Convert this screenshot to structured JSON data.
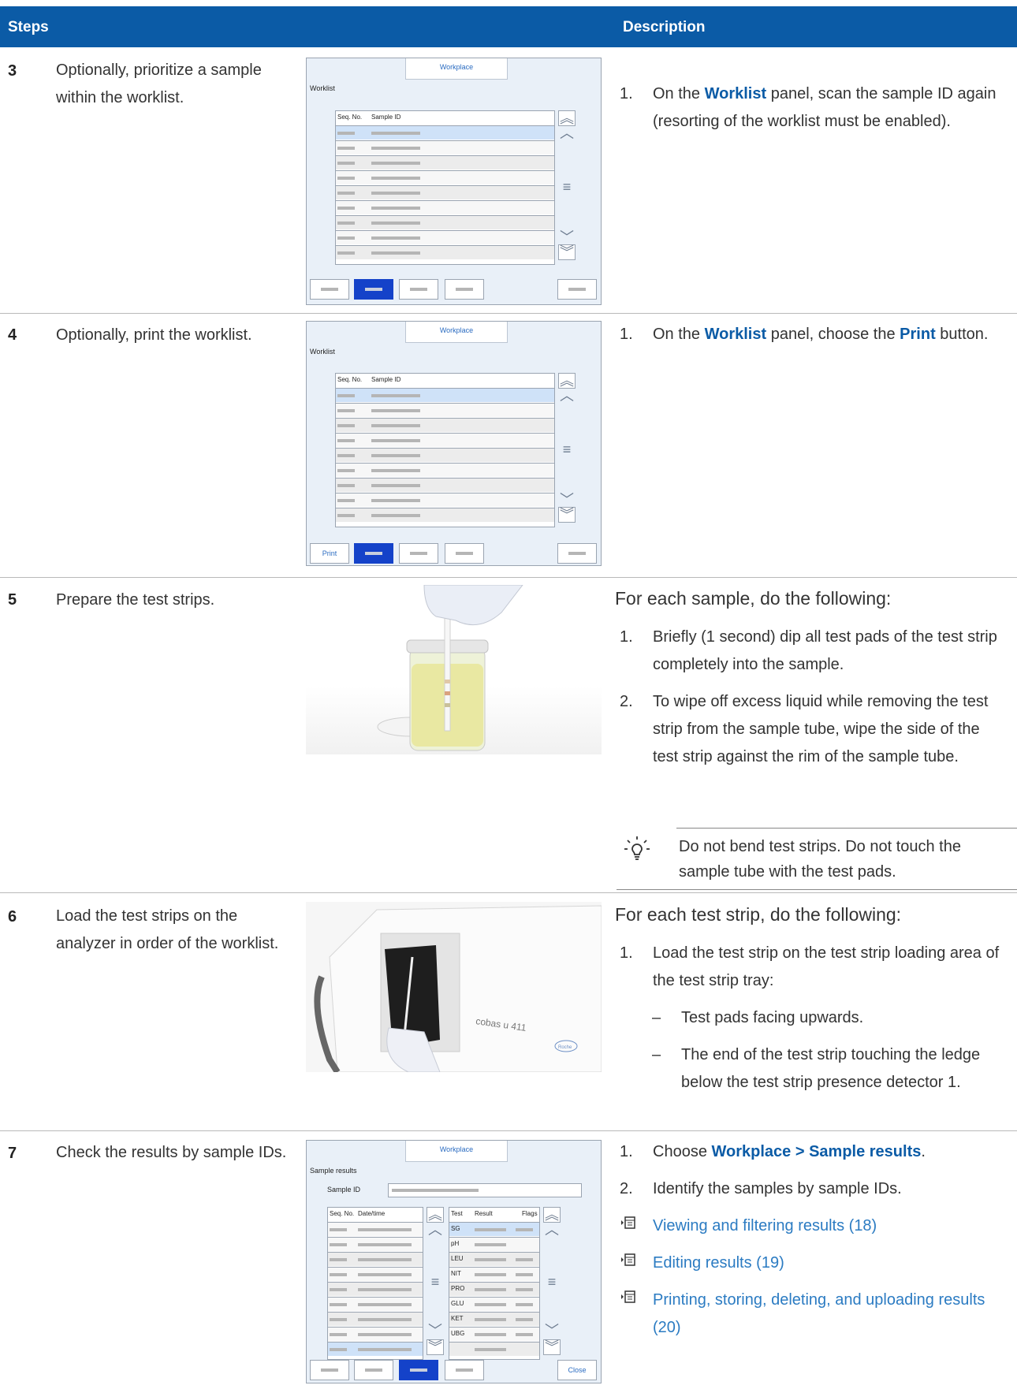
{
  "header": {
    "steps": "Steps",
    "description": "Description"
  },
  "rows": [
    {
      "num": "3",
      "text": "Optionally, prioritize a sample within the worklist.",
      "desc": {
        "n": "1.",
        "pre": "On the ",
        "bold": "Worklist",
        "post": " panel, scan the sample ID again (resorting of the worklist must be enabled)."
      }
    },
    {
      "num": "4",
      "text": "Optionally, print the worklist.",
      "desc": {
        "n": "1.",
        "pre": "On the ",
        "bold1": "Worklist",
        "mid": " panel, choose the ",
        "bold2": "Print",
        "post": " button."
      }
    },
    {
      "num": "5",
      "text": "Prepare the test strips.",
      "intro": "For each sample, do the following:",
      "items": [
        {
          "n": "1.",
          "t": "Briefly (1 second) dip all test pads of the test strip completely into the sample."
        },
        {
          "n": "2.",
          "t": "To wipe off excess liquid while removing the test strip from the sample tube, wipe the side of the test strip against the rim of the sample tube."
        }
      ],
      "tip": "Do not bend test strips. Do not touch the sample tube with the test pads."
    },
    {
      "num": "6",
      "text": "Load the test strips on the analyzer in order of the worklist.",
      "intro": "For each test strip, do the following:",
      "items": [
        {
          "n": "1.",
          "t": "Load the test strip on the test strip loading area of the test strip tray:"
        }
      ],
      "dashes": [
        "Test pads facing upwards.",
        "The end of the test strip touching the ledge below the test strip presence detector 1."
      ],
      "brand": "cobas u 411",
      "logo": "Roche"
    },
    {
      "num": "7",
      "text": "Check the results by sample IDs.",
      "items": [
        {
          "n": "1.",
          "pre": "Choose ",
          "bold": "Workplace > Sample results",
          "post": "."
        },
        {
          "n": "2.",
          "t": "Identify the samples by sample IDs."
        }
      ],
      "links": [
        "Viewing and filtering results (18)",
        "Editing results (19)",
        "Printing, storing, deleting, and uploading results (20)"
      ]
    }
  ],
  "screens": {
    "tab": "Workplace",
    "worklist_title": "Worklist",
    "col_seq": "Seq. No.",
    "col_sample": "Sample ID",
    "print_label": "Print",
    "results_title": "Sample results",
    "sample_id_label": "Sample ID",
    "col_datetime": "Date/time",
    "col_test": "Test",
    "col_result": "Result",
    "col_flags": "Flags",
    "tests": [
      "SG",
      "pH",
      "LEU",
      "NIT",
      "PRO",
      "GLU",
      "KET",
      "UBG"
    ],
    "close_label": "Close"
  },
  "colors": {
    "header": "#0b5ba6",
    "bold_text": "#0b5ba6",
    "link": "#2b7bc2",
    "selected_button": "#1442c9"
  }
}
